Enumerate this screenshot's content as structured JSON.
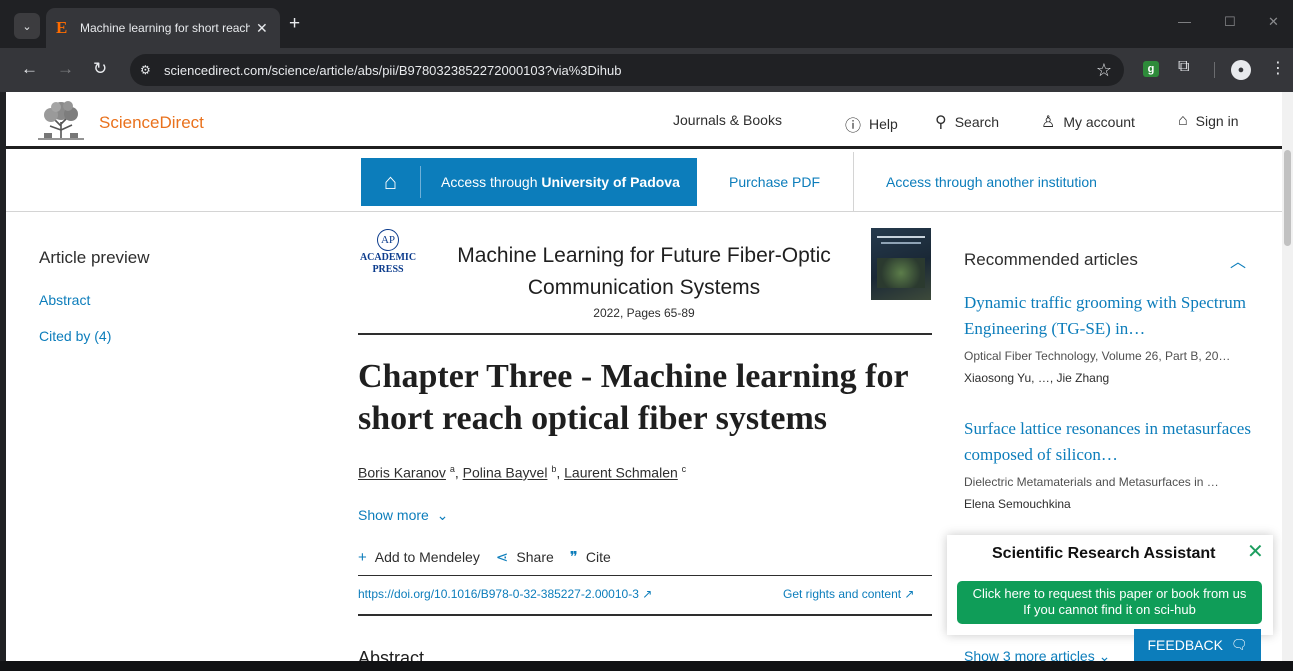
{
  "browser": {
    "tab_title": "Machine learning for short reach",
    "tab_favicon": "E",
    "url": "sciencedirect.com/science/article/abs/pii/B9780323852272000103?via%3Dihub",
    "extension_badge": "g"
  },
  "header": {
    "logo_text": "ScienceDirect",
    "nav": {
      "journals": "Journals & Books",
      "help": "Help",
      "search": "Search",
      "account": "My account",
      "signin": "Sign in"
    }
  },
  "access": {
    "button_prefix": "Access through ",
    "button_institution": "University of Padova",
    "purchase": "Purchase PDF",
    "other": "Access through another institution"
  },
  "sidebar": {
    "title": "Article preview",
    "links": [
      "Abstract",
      "Cited by (4)"
    ]
  },
  "publisher": {
    "logo_mark": "AP",
    "logo_line1": "ACADEMIC",
    "logo_line2": "PRESS"
  },
  "book": {
    "title": "Machine Learning for Future Fiber-Optic Communication Systems",
    "pages": "2022, Pages 65-89"
  },
  "article": {
    "title": "Chapter Three - Machine learning for short reach optical fiber systems",
    "authors": [
      {
        "name": "Boris Karanov",
        "aff": "a"
      },
      {
        "name": "Polina Bayvel",
        "aff": "b"
      },
      {
        "name": "Laurent Schmalen",
        "aff": "c"
      }
    ],
    "show_more": "Show more",
    "actions": {
      "mendeley": "Add to Mendeley",
      "share": "Share",
      "cite": "Cite"
    },
    "doi": "https://doi.org/10.1016/B978-0-32-385227-2.00010-3",
    "rights": "Get rights and content",
    "abstract_heading": "Abstract"
  },
  "recommended": {
    "title": "Recommended articles",
    "items": [
      {
        "title": "Dynamic traffic grooming with Spectrum Engineering (TG-SE) in…",
        "source": "Optical Fiber Technology, Volume 26, Part B, 20…",
        "authors": "Xiaosong Yu, …, Jie Zhang"
      },
      {
        "title": "Surface lattice resonances in metasurfaces composed of silicon…",
        "source": "Dielectric Metamaterials and Metasurfaces in …",
        "authors": "Elena Semouchkina"
      }
    ],
    "show_more": "Show 3 more articles"
  },
  "assistant": {
    "title": "Scientific Research Assistant",
    "button_line1": "Click here to request this paper or book from us",
    "button_line2": "If you cannot find it on sci-hub"
  },
  "feedback": "FEEDBACK",
  "colors": {
    "brand_orange": "#e9711c",
    "link_blue": "#0c7dbb",
    "assistant_green": "#0f9d58"
  }
}
